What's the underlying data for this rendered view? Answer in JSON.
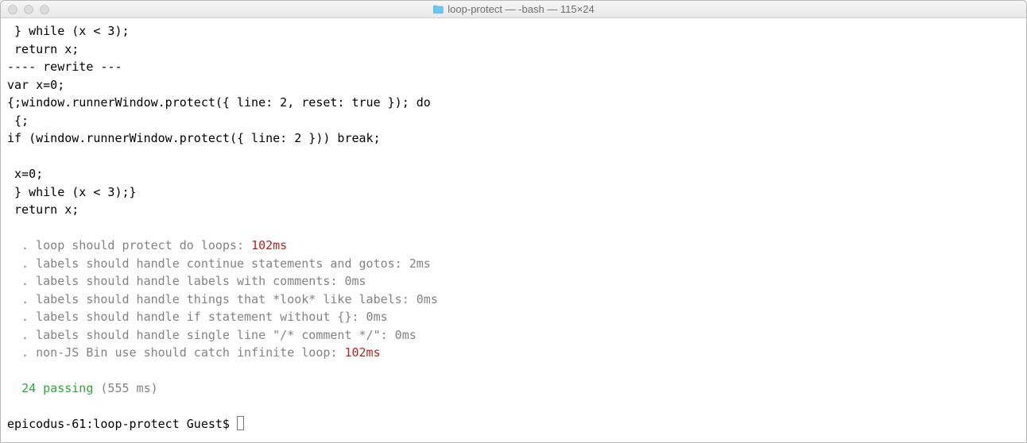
{
  "window": {
    "title": "loop-protect — -bash — 115×24"
  },
  "code": {
    "line1": " } while (x < 3);",
    "line2": " return x;",
    "line3": "---- rewrite ---",
    "line4": "var x=0;",
    "line5": "{;window.runnerWindow.protect({ line: 2, reset: true }); do",
    "line6": " {;",
    "line7": "if (window.runnerWindow.protect({ line: 2 })) break;",
    "line8": "",
    "line9": " x=0;",
    "line10": " } while (x < 3);}",
    "line11": " return x;"
  },
  "tests": [
    {
      "bullet": "  . ",
      "label": "loop should protect do loops:",
      "time": "102ms",
      "slow": true
    },
    {
      "bullet": "  . ",
      "label": "labels should handle continue statements and gotos:",
      "time": "2ms",
      "slow": false
    },
    {
      "bullet": "  . ",
      "label": "labels should handle labels with comments:",
      "time": "0ms",
      "slow": false
    },
    {
      "bullet": "  . ",
      "label": "labels should handle things that *look* like labels:",
      "time": "0ms",
      "slow": false
    },
    {
      "bullet": "  . ",
      "label": "labels should handle if statement without {}:",
      "time": "0ms",
      "slow": false
    },
    {
      "bullet": "  . ",
      "label": "labels should handle single line \"/* comment */\":",
      "time": "0ms",
      "slow": false
    },
    {
      "bullet": "  . ",
      "label": "non-JS Bin use should catch infinite loop:",
      "time": "102ms",
      "slow": true
    }
  ],
  "summary": {
    "indent": "  ",
    "passing": "24 passing",
    "duration": "(555 ms)"
  },
  "prompt": {
    "text": "epicodus-61:loop-protect Guest$ "
  }
}
